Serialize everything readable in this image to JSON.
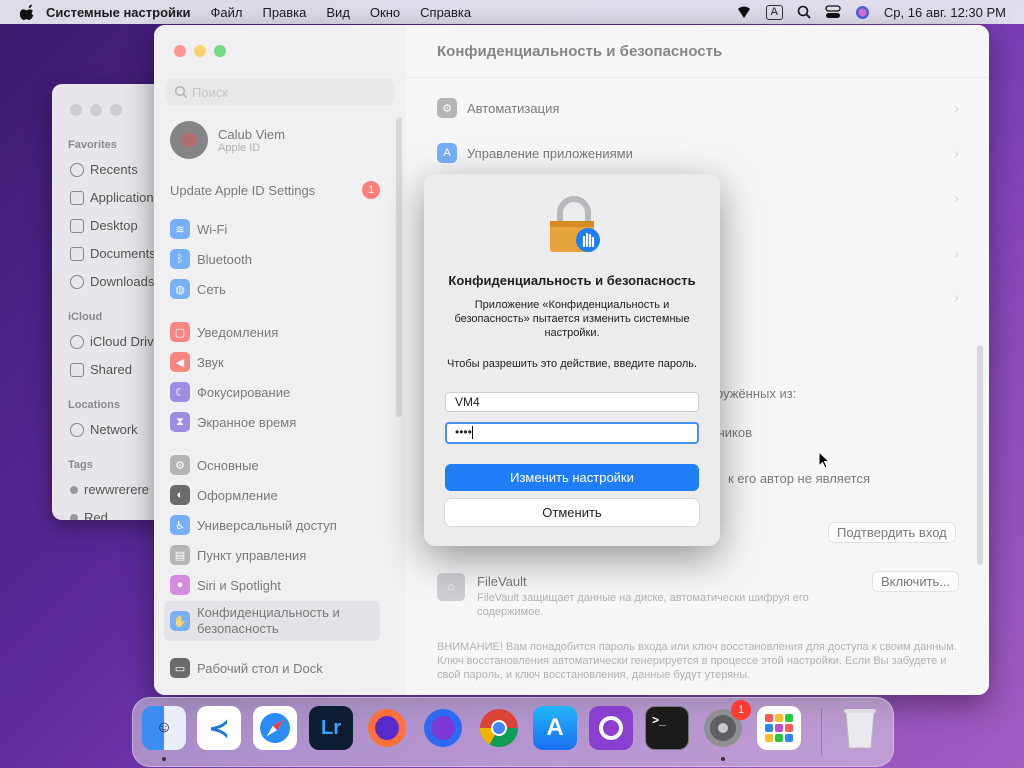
{
  "menubar": {
    "app": "Системные настройки",
    "items": [
      "Файл",
      "Правка",
      "Вид",
      "Окно",
      "Справка"
    ],
    "input_source": "A",
    "datetime": "Ср, 16 авг.  12:30 PM"
  },
  "finder": {
    "sections": {
      "favorites": "Favorites",
      "icloud": "iCloud",
      "locations": "Locations",
      "tags": "Tags"
    },
    "favorites": [
      "Recents",
      "Applications",
      "Desktop",
      "Documents",
      "Downloads"
    ],
    "icloud": [
      "iCloud Drive",
      "Shared"
    ],
    "locations": [
      "Network"
    ],
    "tags": [
      "rewwrerere",
      "Red"
    ]
  },
  "sidebar": {
    "search_placeholder": "Поиск",
    "account_name": "Calub Viem",
    "account_sub": "Apple ID",
    "update_label": "Update Apple ID Settings",
    "update_badge": "1",
    "items": [
      {
        "label": "Wi-Fi",
        "color": "#2f86f6"
      },
      {
        "label": "Bluetooth",
        "color": "#2f86f6"
      },
      {
        "label": "Сеть",
        "color": "#2f86f6"
      },
      {
        "label": "Уведомления",
        "color": "#f2453d"
      },
      {
        "label": "Звук",
        "color": "#f2453d"
      },
      {
        "label": "Фокусирование",
        "color": "#6a4fd8"
      },
      {
        "label": "Экранное время",
        "color": "#6a4fd8"
      },
      {
        "label": "Основные",
        "color": "#8e8e93"
      },
      {
        "label": "Оформление",
        "color": "#1c1c1e"
      },
      {
        "label": "Универсальный доступ",
        "color": "#2f86f6"
      },
      {
        "label": "Пункт управления",
        "color": "#8e8e93"
      },
      {
        "label": "Siri и Spotlight",
        "color": "#c04fd0"
      },
      {
        "label": "Конфиденциальность и безопасность",
        "color": "#2f86f6"
      },
      {
        "label": "Рабочий стол и Dock",
        "color": "#1c1c1e"
      }
    ]
  },
  "main": {
    "title": "Конфиденциальность и безопасность",
    "row_automation": "Автоматизация",
    "row_app_management": "Управление приложениями",
    "partial_downloaded": "ружённых из:",
    "partial_developers": "чиков",
    "partial_author": "к его автор не является",
    "confirm_login": "Подтвердить вход",
    "filevault_title": "FileVault",
    "filevault_desc": "FileVault защищает данные на диске, автоматически шифруя его содержимое.",
    "filevault_button": "Включить...",
    "warning": "ВНИМАНИЕ! Вам понадобится пароль входа или ключ восстановления для доступа к своим данным. Ключ восстановления автоматически генерируется в процессе этой настройки. Если Вы забудете и свой пароль, и ключ восстановления, данные будут утеряны."
  },
  "dialog": {
    "title": "Конфиденциальность и безопасность",
    "message": "Приложение «Конфиденциальность и безопасность» пытается изменить системные настройки.",
    "prompt": "Чтобы разрешить это действие, введите пароль.",
    "username": "VM4",
    "password_mask": "••••",
    "primary_button": "Изменить настройки",
    "cancel_button": "Отменить"
  },
  "dock": {
    "settings_badge": "1",
    "apps": [
      "Finder",
      "Visual Studio Code",
      "Safari",
      "Lightroom",
      "Firefox",
      "Firefox Developer",
      "Chrome",
      "App Store",
      "GitHub Desktop",
      "Terminal",
      "System Settings",
      "Launchpad",
      "Trash"
    ],
    "lightroom_label": "Lr"
  }
}
